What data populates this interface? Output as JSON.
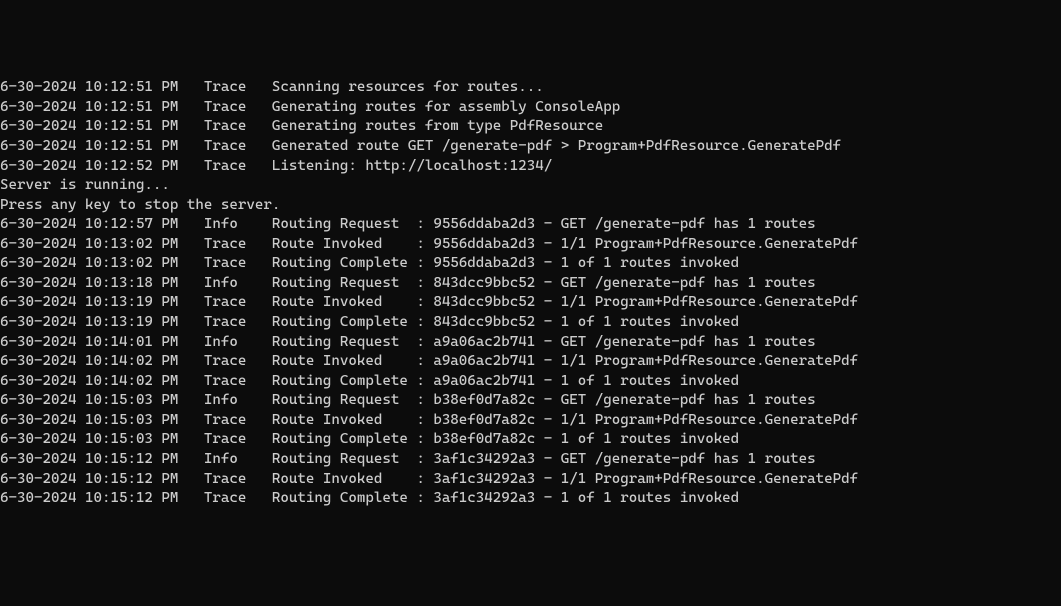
{
  "lines": [
    {
      "type": "log",
      "ts": "6-30-2024 10:12:51 PM",
      "level": "Trace",
      "msg": "Scanning resources for routes..."
    },
    {
      "type": "log",
      "ts": "6-30-2024 10:12:51 PM",
      "level": "Trace",
      "msg": "Generating routes for assembly ConsoleApp"
    },
    {
      "type": "log",
      "ts": "6-30-2024 10:12:51 PM",
      "level": "Trace",
      "msg": "Generating routes from type PdfResource"
    },
    {
      "type": "log",
      "ts": "6-30-2024 10:12:51 PM",
      "level": "Trace",
      "msg": "Generated route GET /generate-pdf > Program+PdfResource.GeneratePdf"
    },
    {
      "type": "log",
      "ts": "6-30-2024 10:12:52 PM",
      "level": "Trace",
      "msg": "Listening: http://localhost:1234/"
    },
    {
      "type": "plain",
      "text": "Server is running..."
    },
    {
      "type": "plain",
      "text": "Press any key to stop the server."
    },
    {
      "type": "log",
      "ts": "6-30-2024 10:12:57 PM",
      "level": "Info",
      "msg": "Routing Request  : 9556ddaba2d3 - GET /generate-pdf has 1 routes"
    },
    {
      "type": "log",
      "ts": "6-30-2024 10:13:02 PM",
      "level": "Trace",
      "msg": "Route Invoked    : 9556ddaba2d3 - 1/1 Program+PdfResource.GeneratePdf"
    },
    {
      "type": "log",
      "ts": "6-30-2024 10:13:02 PM",
      "level": "Trace",
      "msg": "Routing Complete : 9556ddaba2d3 - 1 of 1 routes invoked"
    },
    {
      "type": "log",
      "ts": "6-30-2024 10:13:18 PM",
      "level": "Info",
      "msg": "Routing Request  : 843dcc9bbc52 - GET /generate-pdf has 1 routes"
    },
    {
      "type": "log",
      "ts": "6-30-2024 10:13:19 PM",
      "level": "Trace",
      "msg": "Route Invoked    : 843dcc9bbc52 - 1/1 Program+PdfResource.GeneratePdf"
    },
    {
      "type": "log",
      "ts": "6-30-2024 10:13:19 PM",
      "level": "Trace",
      "msg": "Routing Complete : 843dcc9bbc52 - 1 of 1 routes invoked"
    },
    {
      "type": "log",
      "ts": "6-30-2024 10:14:01 PM",
      "level": "Info",
      "msg": "Routing Request  : a9a06ac2b741 - GET /generate-pdf has 1 routes"
    },
    {
      "type": "log",
      "ts": "6-30-2024 10:14:02 PM",
      "level": "Trace",
      "msg": "Route Invoked    : a9a06ac2b741 - 1/1 Program+PdfResource.GeneratePdf"
    },
    {
      "type": "log",
      "ts": "6-30-2024 10:14:02 PM",
      "level": "Trace",
      "msg": "Routing Complete : a9a06ac2b741 - 1 of 1 routes invoked"
    },
    {
      "type": "log",
      "ts": "6-30-2024 10:15:03 PM",
      "level": "Info",
      "msg": "Routing Request  : b38ef0d7a82c - GET /generate-pdf has 1 routes"
    },
    {
      "type": "log",
      "ts": "6-30-2024 10:15:03 PM",
      "level": "Trace",
      "msg": "Route Invoked    : b38ef0d7a82c - 1/1 Program+PdfResource.GeneratePdf"
    },
    {
      "type": "log",
      "ts": "6-30-2024 10:15:03 PM",
      "level": "Trace",
      "msg": "Routing Complete : b38ef0d7a82c - 1 of 1 routes invoked"
    },
    {
      "type": "log",
      "ts": "6-30-2024 10:15:12 PM",
      "level": "Info",
      "msg": "Routing Request  : 3af1c34292a3 - GET /generate-pdf has 1 routes"
    },
    {
      "type": "log",
      "ts": "6-30-2024 10:15:12 PM",
      "level": "Trace",
      "msg": "Route Invoked    : 3af1c34292a3 - 1/1 Program+PdfResource.GeneratePdf"
    },
    {
      "type": "log",
      "ts": "6-30-2024 10:15:12 PM",
      "level": "Trace",
      "msg": "Routing Complete : 3af1c34292a3 - 1 of 1 routes invoked"
    }
  ],
  "columns": {
    "ts_width": 21,
    "level_width": 8
  }
}
